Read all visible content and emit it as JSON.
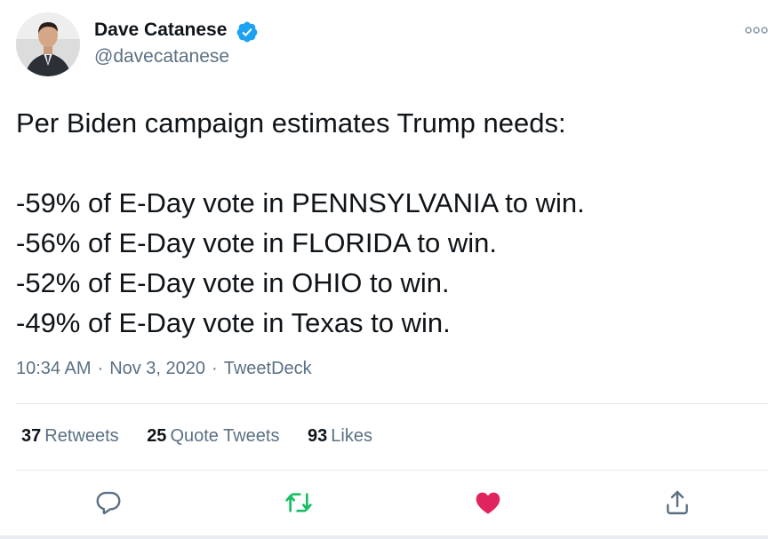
{
  "author": {
    "display_name": "Dave Catanese",
    "handle": "@davecatanese",
    "verified": true,
    "avatar_icon": "profile-photo"
  },
  "tweet": {
    "lines": [
      "Per Biden campaign estimates Trump needs:",
      "-59% of E-Day vote in PENNSYLVANIA to win.",
      "-56% of E-Day vote in FLORIDA to win.",
      "-52% of E-Day vote in OHIO to win.",
      "-49% of E-Day vote in Texas to win."
    ]
  },
  "meta": {
    "time": "10:34 AM",
    "date": "Nov 3, 2020",
    "source": "TweetDeck",
    "separator": "·"
  },
  "stats": {
    "retweets": {
      "count": "37",
      "label": "Retweets"
    },
    "quote_tweets": {
      "count": "25",
      "label": "Quote Tweets"
    },
    "likes": {
      "count": "93",
      "label": "Likes"
    }
  },
  "actions": {
    "reply_icon": "reply-icon",
    "retweet_icon": "retweet-icon",
    "like_icon": "heart-icon",
    "share_icon": "share-icon",
    "liked": true,
    "retweeted": true
  },
  "colors": {
    "verified": "#1da1f2",
    "retweet_active": "#17bf63",
    "like_active": "#e0245e",
    "secondary_text": "#5b7083",
    "icon": "#5b7083"
  }
}
